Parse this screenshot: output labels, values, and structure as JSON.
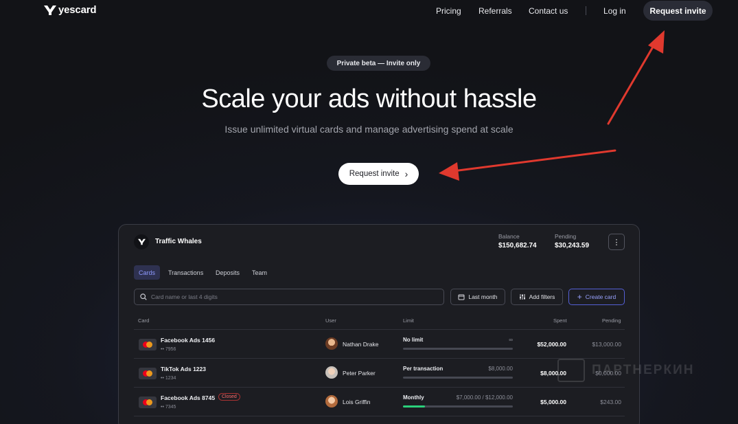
{
  "brand": {
    "name": "yescard"
  },
  "nav": {
    "links": [
      "Pricing",
      "Referrals",
      "Contact us"
    ],
    "login": "Log in",
    "cta": "Request invite"
  },
  "hero": {
    "badge": "Private beta — Invite only",
    "title": "Scale your ads without hassle",
    "subtitle": "Issue unlimited virtual cards and manage advertising spend at scale",
    "cta": "Request invite"
  },
  "dashboard": {
    "account": "Traffic Whales",
    "balance_label": "Balance",
    "balance_value": "$150,682.74",
    "pending_label": "Pending",
    "pending_value": "$30,243.59",
    "tabs": [
      "Cards",
      "Transactions",
      "Deposits",
      "Team"
    ],
    "search_placeholder": "Card name or last 4 digits",
    "filters": {
      "date": "Last month",
      "add": "Add filters",
      "create": "Create card"
    },
    "columns": {
      "card": "Card",
      "user": "User",
      "limit": "Limit",
      "spent": "Spent",
      "pending": "Pending"
    },
    "rows": [
      {
        "name": "Facebook Ads 1456",
        "number": "•• 7956",
        "user": "Nathan Drake",
        "limit_type": "No limit",
        "limit_value": "∞",
        "spent": "$52,000.00",
        "pending": "$13,000.00",
        "closed": "",
        "progress": 0
      },
      {
        "name": "TikTok Ads 1223",
        "number": "•• 1234",
        "user": "Peter Parker",
        "limit_type": "Per transaction",
        "limit_value": "$8,000.00",
        "spent": "$8,000.00",
        "pending": "$0,000.00",
        "closed": "",
        "progress": 0
      },
      {
        "name": "Facebook Ads 8745",
        "number": "•• 7345",
        "user": "Lois Griffin",
        "limit_type": "Monthly",
        "limit_value": "$7,000.00 / $12,000.00",
        "spent": "$5,000.00",
        "pending": "$243.00",
        "closed": "Closed",
        "progress": 0.2
      }
    ]
  },
  "watermark": "ПАРТНЕРКИН",
  "colors": {
    "accent": "#5560d6",
    "arrow": "#e0392e",
    "background": "#15171f"
  }
}
